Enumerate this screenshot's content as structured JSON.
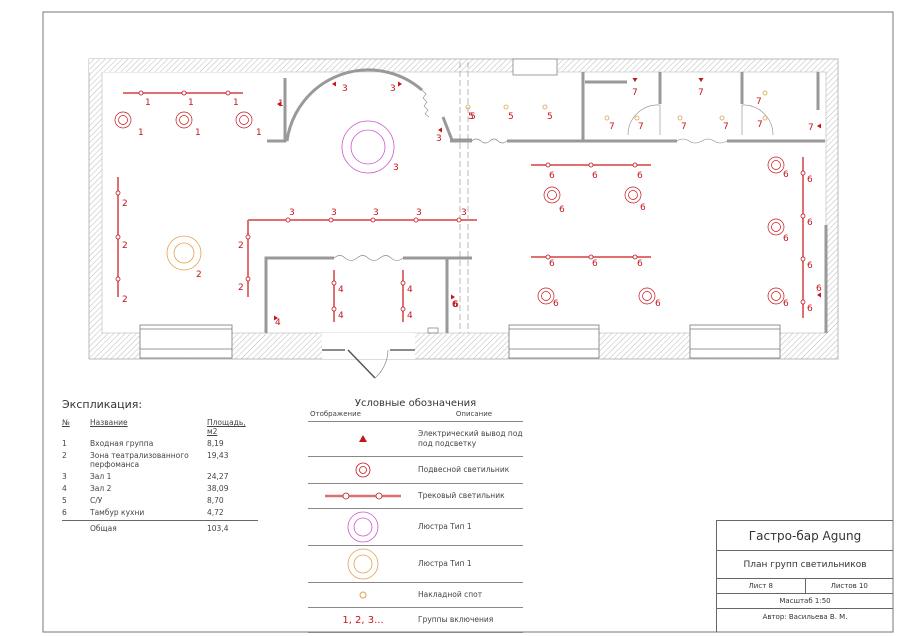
{
  "plan": {
    "labels": [
      "1",
      "1",
      "1",
      "1",
      "1",
      "1",
      "1",
      "3",
      "3",
      "3",
      "3",
      "2",
      "2",
      "2",
      "2",
      "3",
      "3",
      "3",
      "3",
      "3",
      "2",
      "2",
      "4",
      "4",
      "4",
      "4",
      "4",
      "6",
      "5",
      "5",
      "5",
      "5",
      "7",
      "7",
      "7",
      "7",
      "7",
      "7",
      "7",
      "7",
      "7",
      "6",
      "6",
      "6",
      "6",
      "6",
      "6",
      "6",
      "6",
      "6",
      "6",
      "6",
      "6",
      "6",
      "6",
      "6",
      "6",
      "6",
      "6",
      "6",
      "6"
    ]
  },
  "explication": {
    "title": "Экспликация:",
    "headers": {
      "num": "№",
      "name": "Название",
      "area": "Площадь, м2"
    },
    "rows": [
      {
        "num": "1",
        "name": "Входная группа",
        "area": "8,19"
      },
      {
        "num": "2",
        "name": "Зона театрализованного перфоманса",
        "area": "19,43"
      },
      {
        "num": "3",
        "name": "Зал 1",
        "area": "24,27"
      },
      {
        "num": "4",
        "name": "Зал 2",
        "area": "38,09"
      },
      {
        "num": "5",
        "name": "С/У",
        "area": "8,70"
      },
      {
        "num": "6",
        "name": "Тамбур кухни",
        "area": "4,72"
      }
    ],
    "total": {
      "name": "Общая",
      "area": "103,4"
    }
  },
  "legend": {
    "title": "Условные обозначения",
    "col_display": "Отображение",
    "col_description": "Описание",
    "items": [
      {
        "icon": "electric-outlet-arrow-icon",
        "desc": "Электрический вывод под под подсветку"
      },
      {
        "icon": "pendant-lamp-icon",
        "desc": "Подвесной светильник"
      },
      {
        "icon": "track-lamp-icon",
        "desc": "Трековый светильник"
      },
      {
        "icon": "chandelier-type1-purple-icon",
        "desc": "Люстра Тип 1"
      },
      {
        "icon": "chandelier-type1-orange-icon",
        "desc": "Люстра Тип 1"
      },
      {
        "icon": "surface-spot-icon",
        "desc": "Накладной спот"
      },
      {
        "icon": "group-numbers",
        "symbol": "1, 2, 3...",
        "desc": "Группы включения"
      }
    ]
  },
  "title_block": {
    "project": "Гастро-бар Agung",
    "sheet_name": "План групп светильников",
    "sheet": "Лист 8",
    "sheets_total": "Листов 10",
    "scale": "Масштаб 1:50",
    "author": "Автор: Васильева В. М."
  },
  "colors": {
    "red": "#c4151c",
    "track": "#e07070",
    "purple": "#cc55cc",
    "orange": "#e0a050",
    "wall": "#999999"
  }
}
